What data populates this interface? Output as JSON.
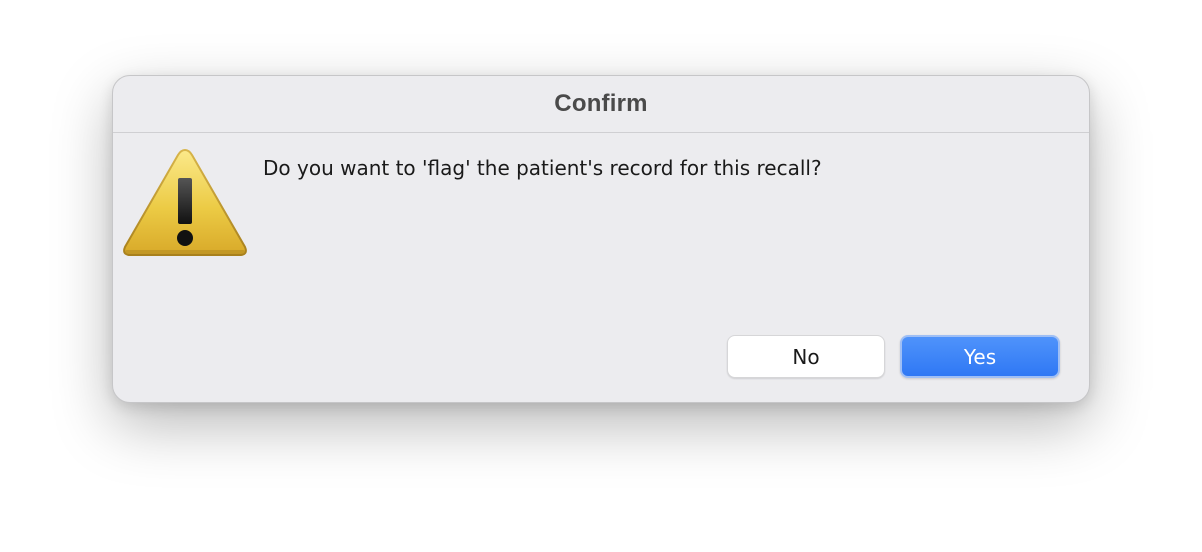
{
  "dialog": {
    "title": "Confirm",
    "icon": "warning-icon",
    "message": "Do you want to 'flag' the patient's record for this recall?",
    "buttons": {
      "no_label": "No",
      "yes_label": "Yes"
    },
    "colors": {
      "accent": "#3b82f6",
      "background": "#ececef",
      "warning": "#e9c132"
    }
  }
}
